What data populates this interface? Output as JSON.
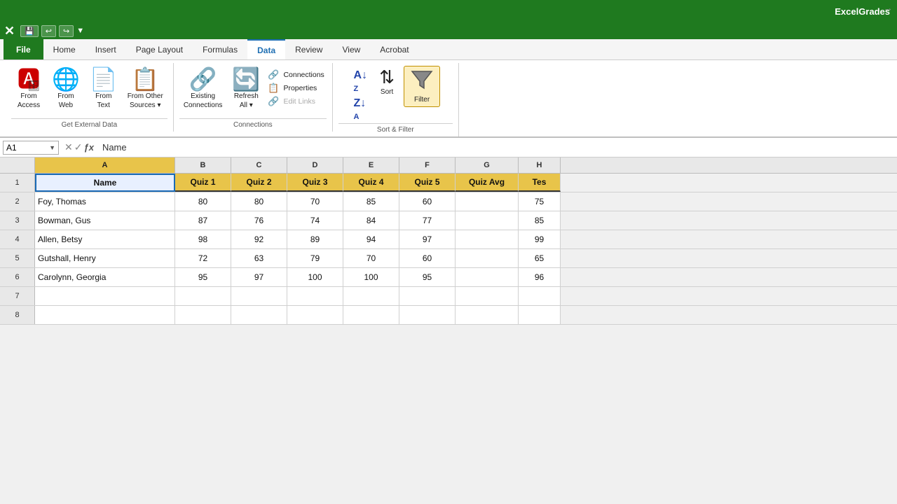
{
  "titleBar": {
    "appName": "ExcelGrades"
  },
  "menuBar": {
    "items": [
      "File",
      "Home",
      "Insert",
      "Page Layout",
      "Formulas",
      "Data",
      "Review",
      "View",
      "Acrobat"
    ]
  },
  "ribbon": {
    "groups": {
      "getExternalData": {
        "label": "Get External Data",
        "buttons": [
          {
            "id": "from-access",
            "icon": "🅰",
            "label": "From\nAccess",
            "iconColor": "#c00"
          },
          {
            "id": "from-web",
            "icon": "🌐",
            "label": "From\nWeb",
            "iconColor": "#1a6ab5"
          },
          {
            "id": "from-text",
            "icon": "📄",
            "label": "From\nText",
            "iconColor": "#d4a000"
          },
          {
            "id": "from-other",
            "icon": "📋",
            "label": "From Other\nSources",
            "iconColor": "#d4a000",
            "hasDropdown": true
          }
        ]
      },
      "connections": {
        "label": "Connections",
        "existingLabel": "Existing\nConnections",
        "refreshAllLabel": "Refresh\nAll",
        "connectionsLabel": "Connections",
        "propertiesLabel": "Properties",
        "editLinksLabel": "Edit Links"
      },
      "sortFilter": {
        "label": "Sort & Filter",
        "sortLabel": "Sort",
        "filterLabel": "Filter",
        "azLabel": "A↓Z",
        "zaLabel": "Z↓A"
      }
    }
  },
  "formulaBar": {
    "cellRef": "A1",
    "formula": "Name"
  },
  "columns": [
    "A",
    "B",
    "C",
    "D",
    "E",
    "F",
    "G",
    "H"
  ],
  "headers": [
    "Name",
    "Quiz 1",
    "Quiz 2",
    "Quiz 3",
    "Quiz 4",
    "Quiz 5",
    "Quiz Avg",
    "Tes"
  ],
  "rows": [
    {
      "num": 1,
      "cells": [
        "Name",
        "Quiz 1",
        "Quiz 2",
        "Quiz 3",
        "Quiz 4",
        "Quiz 5",
        "Quiz Avg",
        "Tes"
      ],
      "isHeader": true
    },
    {
      "num": 2,
      "cells": [
        "Foy, Thomas",
        "80",
        "80",
        "70",
        "85",
        "60",
        "",
        "75"
      ],
      "isHeader": false
    },
    {
      "num": 3,
      "cells": [
        "Bowman, Gus",
        "87",
        "76",
        "74",
        "84",
        "77",
        "",
        "85"
      ],
      "isHeader": false
    },
    {
      "num": 4,
      "cells": [
        "Allen, Betsy",
        "98",
        "92",
        "89",
        "94",
        "97",
        "",
        "99"
      ],
      "isHeader": false
    },
    {
      "num": 5,
      "cells": [
        "Gutshall, Henry",
        "72",
        "63",
        "79",
        "70",
        "60",
        "",
        "65"
      ],
      "isHeader": false
    },
    {
      "num": 6,
      "cells": [
        "Carolynn, Georgia",
        "95",
        "97",
        "100",
        "100",
        "95",
        "",
        "96"
      ],
      "isHeader": false
    },
    {
      "num": 7,
      "cells": [
        "",
        "",
        "",
        "",
        "",
        "",
        "",
        ""
      ],
      "isHeader": false
    },
    {
      "num": 8,
      "cells": [
        "",
        "",
        "",
        "",
        "",
        "",
        "",
        ""
      ],
      "isHeader": false
    }
  ]
}
